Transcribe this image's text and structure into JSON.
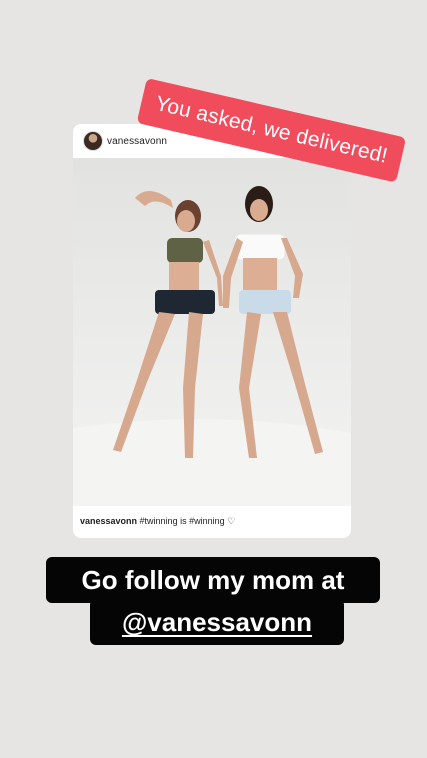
{
  "post": {
    "username": "vanessavonn",
    "caption_user": "vanessavonn",
    "caption_text": "#twinning is #winning ♡"
  },
  "sticker": {
    "text": "You asked, we delivered!"
  },
  "story_text": {
    "line1": "Go follow my mom at",
    "line2": "@vanessavonn"
  },
  "colors": {
    "background": "#e6e5e4",
    "sticker": "#f04c5c",
    "text_box": "#050505"
  }
}
